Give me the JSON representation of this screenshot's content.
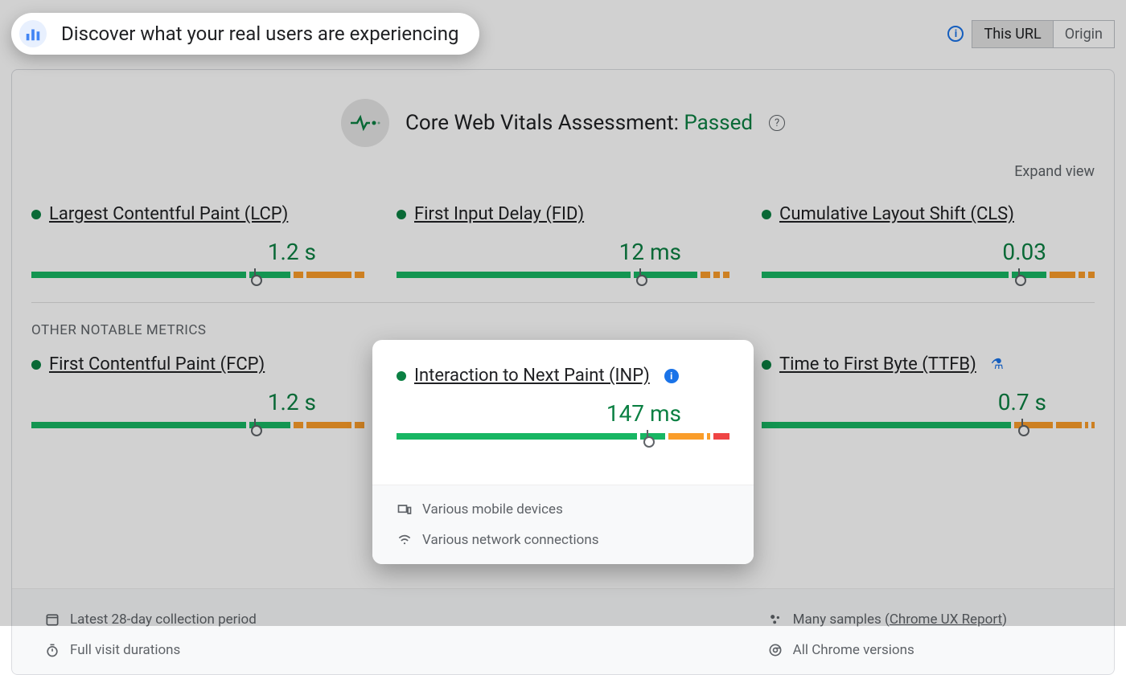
{
  "header": {
    "title": "Discover what your real users are experiencing",
    "toggle": {
      "thisUrl": "This URL",
      "origin": "Origin"
    }
  },
  "assessment": {
    "labelPrefix": "Core Web Vitals Assessment: ",
    "status": "Passed"
  },
  "expandView": "Expand view",
  "coreMetrics": [
    {
      "name": "Largest Contentful Paint (LCP)",
      "value": "1.2 s",
      "segs": [
        67,
        13,
        3,
        14,
        3
      ],
      "colors": [
        "green",
        "green",
        "orange",
        "orange",
        "orange"
      ],
      "marker": 67
    },
    {
      "name": "First Input Delay (FID)",
      "value": "12 ms",
      "segs": [
        73,
        20,
        3,
        2,
        2
      ],
      "colors": [
        "green",
        "green",
        "orange",
        "orange",
        "orange"
      ],
      "marker": 73
    },
    {
      "name": "Cumulative Layout Shift (CLS)",
      "value": "0.03",
      "segs": [
        77,
        11,
        8,
        2,
        2
      ],
      "colors": [
        "green",
        "green",
        "orange",
        "orange",
        "orange"
      ],
      "marker": 77
    }
  ],
  "otherLabel": "OTHER NOTABLE METRICS",
  "otherMetrics": {
    "fcp": {
      "name": "First Contentful Paint (FCP)",
      "value": "1.2 s",
      "segs": [
        67,
        13,
        3,
        14,
        3
      ],
      "colors": [
        "green",
        "green",
        "orange",
        "orange",
        "orange"
      ],
      "marker": 67
    },
    "inp": {
      "name": "Interaction to Next Paint (INP)",
      "value": "147 ms",
      "segs": [
        75,
        8,
        11,
        1,
        5
      ],
      "colors": [
        "green",
        "green",
        "orange",
        "orange",
        "red"
      ],
      "marker": 75
    },
    "ttfb": {
      "name": "Time to First Byte (TTFB)",
      "value": "0.7 s",
      "segs": [
        78,
        12,
        8,
        1,
        1
      ],
      "colors": [
        "green",
        "orange",
        "orange",
        "orange",
        "orange"
      ],
      "marker": 78
    }
  },
  "footer": {
    "period": "Latest 28-day collection period",
    "duration": "Full visit durations",
    "devices": "Various mobile devices",
    "network": "Various network connections",
    "samplesPrefix": "Many samples (",
    "samplesLink": "Chrome UX Report",
    "samplesSuffix": ")",
    "versions": "All Chrome versions"
  }
}
